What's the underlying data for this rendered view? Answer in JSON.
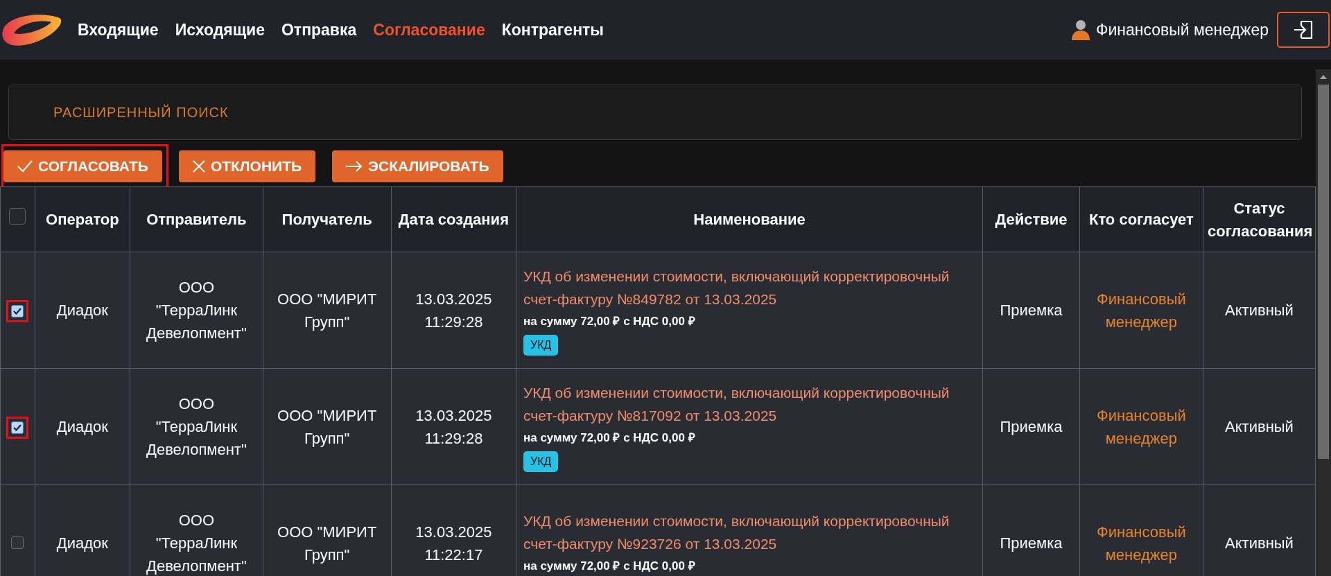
{
  "nav": {
    "items": [
      {
        "label": "Входящие",
        "selected": false
      },
      {
        "label": "Исходящие",
        "selected": false
      },
      {
        "label": "Отправка",
        "selected": false
      },
      {
        "label": "Согласование",
        "selected": true
      },
      {
        "label": "Контрагенты",
        "selected": false
      }
    ],
    "user": "Финансовый менеджер"
  },
  "search": {
    "title": "РАСШИРЕННЫЙ ПОИСК"
  },
  "actions": [
    {
      "kind": "approve",
      "label": "СОГЛАСОВАТЬ",
      "highlighted": true
    },
    {
      "kind": "reject",
      "label": "ОТКЛОНИТЬ",
      "highlighted": false
    },
    {
      "kind": "escalate",
      "label": "ЭСКАЛИРОВАТЬ",
      "highlighted": false
    }
  ],
  "table": {
    "select_all": {
      "checked": false
    },
    "columns": [
      "Оператор",
      "Отправитель",
      "Получатель",
      "Дата создания",
      "Наименование",
      "Действие",
      "Кто согласует",
      "Статус согласования"
    ],
    "rows": [
      {
        "checked": true,
        "highlighted": true,
        "operator": "Диадок",
        "sender": "ООО \"ТерраЛинк Девелопмент\"",
        "recipient": "ООО \"МИРИТ Групп\"",
        "date": "13.03.2025",
        "time": "11:29:28",
        "title": "УКД об изменении стоимости, включающий корректировочный счет-фактуру №849782 от 13.03.2025",
        "amount": "на сумму 72,00 ₽ с НДС 0,00 ₽",
        "tag": "УКД",
        "action": "Приемка",
        "approver": "Финансовый менеджер",
        "status": "Активный"
      },
      {
        "checked": true,
        "highlighted": true,
        "operator": "Диадок",
        "sender": "ООО \"ТерраЛинк Девелопмент\"",
        "recipient": "ООО \"МИРИТ Групп\"",
        "date": "13.03.2025",
        "time": "11:29:28",
        "title": "УКД об изменении стоимости, включающий корректировочный счет-фактуру №817092 от 13.03.2025",
        "amount": "на сумму 72,00 ₽ с НДС 0,00 ₽",
        "tag": "УКД",
        "action": "Приемка",
        "approver": "Финансовый менеджер",
        "status": "Активный"
      },
      {
        "checked": false,
        "highlighted": false,
        "operator": "Диадок",
        "sender": "ООО \"ТерраЛинк Девелопмент\"",
        "recipient": "ООО \"МИРИТ Групп\"",
        "date": "13.03.2025",
        "time": "11:22:17",
        "title": "УКД об изменении стоимости, включающий корректировочный счет-фактуру №923726 от 13.03.2025",
        "amount": "на сумму 72,00 ₽ с НДС 0,00 ₽",
        "action": "Приемка",
        "approver": "Финансовый менеджер",
        "status": "Активный"
      }
    ]
  }
}
